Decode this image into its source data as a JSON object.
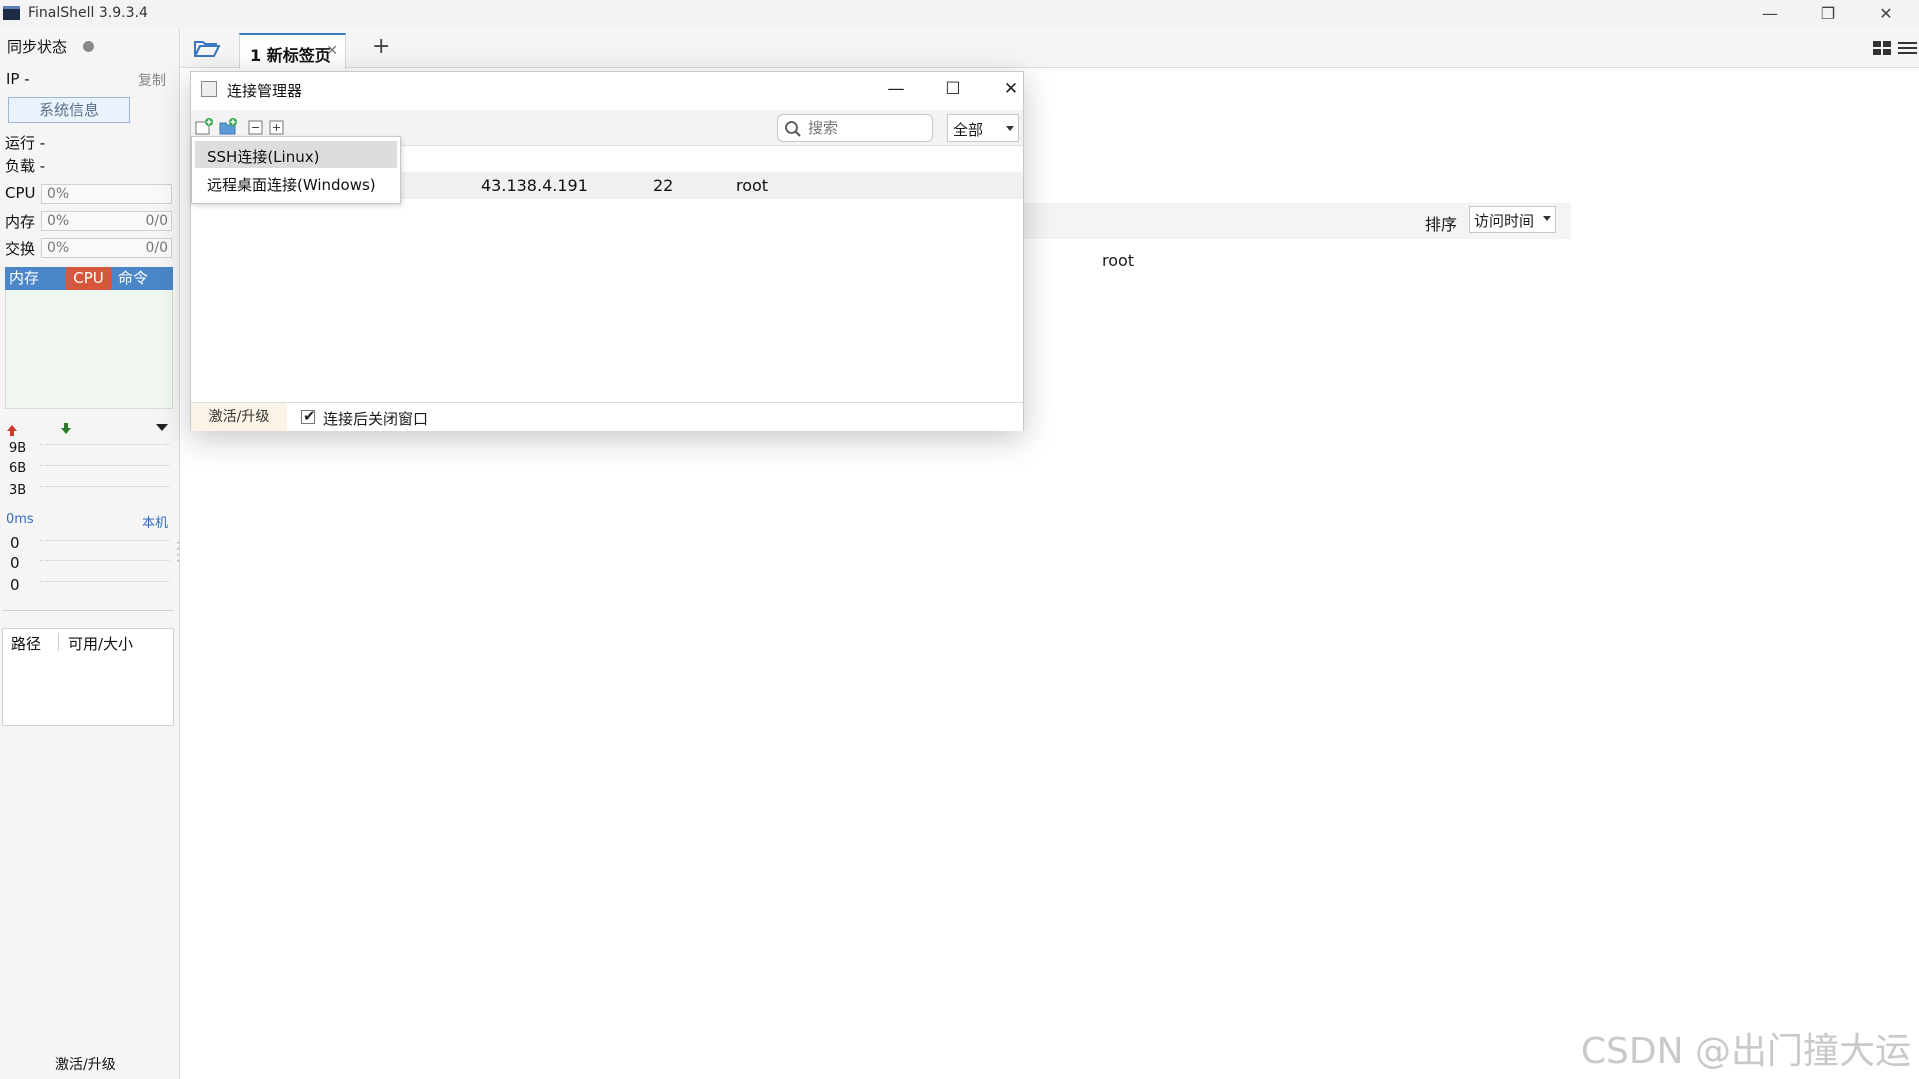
{
  "window": {
    "title": "FinalShell 3.9.3.4",
    "minimize_icon": "minimize-icon",
    "restore_icon": "restore-icon",
    "close_icon": "close-icon"
  },
  "left_panel": {
    "sync_label": "同步状态",
    "ip_label": "IP -",
    "copy_label": "复制",
    "sysinfo_button": "系统信息",
    "run_label": "运行 -",
    "load_label": "负载 -",
    "cpu": {
      "label": "CPU",
      "pct": "0%"
    },
    "mem": {
      "label": "内存",
      "pct": "0%",
      "value": "0/0"
    },
    "swap": {
      "label": "交换",
      "pct": "0%",
      "value": "0/0"
    },
    "monitor_tabs": [
      "内存",
      "CPU",
      "命令"
    ],
    "net_scale": [
      "9B",
      "6B",
      "3B"
    ],
    "ping_label": "0ms",
    "ping_target": "本机",
    "ping_values": [
      "0",
      "0",
      "0"
    ],
    "disk_headers": [
      "路径",
      "可用/大小"
    ],
    "upgrade_label": "激活/升级"
  },
  "tabs": {
    "items": [
      {
        "label": "1 新标签页"
      }
    ],
    "add_label": "+"
  },
  "background": {
    "sort_label": "排序",
    "sort_value": "访问时间",
    "row_user": "root"
  },
  "dialog": {
    "title": "连接管理器",
    "search_placeholder": "搜索",
    "filter_value": "全部",
    "connections": [
      {
        "host": "43.138.4.191",
        "port": "22",
        "user": "root"
      }
    ],
    "footer_upgrade": "激活/升级",
    "close_after_connect_label": "连接后关闭窗口",
    "close_after_connect_checked": "✔"
  },
  "menu": {
    "items": [
      "SSH连接(Linux)",
      "远程桌面连接(Windows)"
    ]
  },
  "watermark": "CSDN @出门撞大运",
  "colors": {
    "accent_blue": "#4a86c8",
    "cpu_tab": "#d6573c",
    "highlight_row": "#f0f0f0"
  }
}
